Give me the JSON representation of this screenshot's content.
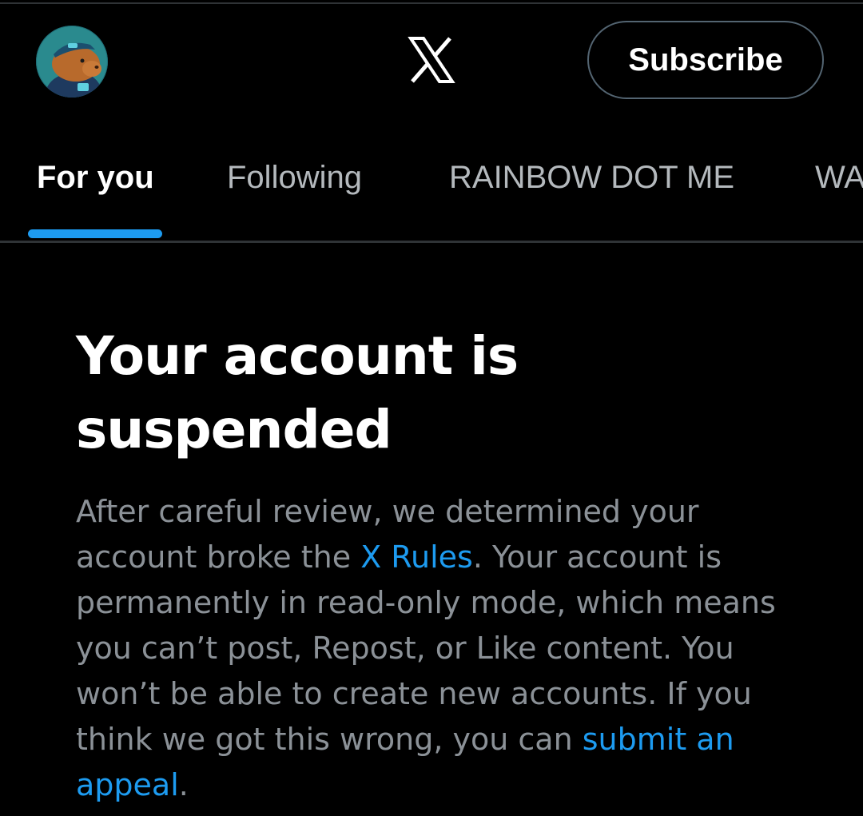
{
  "header": {
    "avatar_alt": "profile avatar",
    "logo_icon": "x-logo-icon",
    "subscribe_label": "Subscribe"
  },
  "tabs": [
    {
      "label": "For you",
      "active": true
    },
    {
      "label": "Following",
      "active": false
    },
    {
      "label": "RAINBOW DOT ME",
      "active": false
    },
    {
      "label": "WA",
      "active": false
    }
  ],
  "notice": {
    "title": "Your account is suspended",
    "body_part1": "After careful review, we determined your account broke the ",
    "rules_link": "X Rules",
    "body_part2": ". Your account is permanently in read-only mode, which means you can’t post, Repost, or Like content. You won’t be able to create new accounts. If you think we got this wrong, you can ",
    "appeal_link": "submit an appeal",
    "body_end": "."
  },
  "colors": {
    "background": "#000000",
    "accent": "#1d9bf0",
    "divider": "#2f3336",
    "body_text": "#8b9197",
    "inactive_tab": "#b4b9bd"
  }
}
